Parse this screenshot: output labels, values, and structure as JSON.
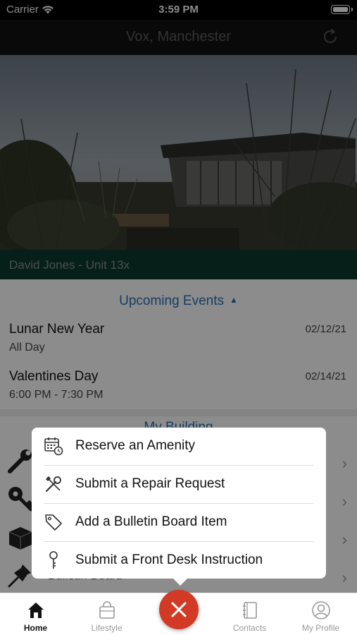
{
  "status_bar": {
    "carrier": "Carrier",
    "time": "3:59 PM"
  },
  "header": {
    "title": "Vox, Manchester"
  },
  "tenant": {
    "label": "David Jones - Unit 13x"
  },
  "events": {
    "heading": "Upcoming Events",
    "items": [
      {
        "name": "Lunar New Year",
        "when": "All Day",
        "date": "02/12/21"
      },
      {
        "name": "Valentines Day",
        "when": "6:00 PM - 7:30 PM",
        "date": "02/14/21"
      }
    ]
  },
  "building": {
    "heading": "My Building",
    "items": [
      {
        "label": "",
        "icon": "wrench-icon"
      },
      {
        "label": "",
        "icon": "key-icon"
      },
      {
        "label": "",
        "icon": "package-icon"
      },
      {
        "label": "Bulletin Board",
        "icon": "pushpin-icon"
      }
    ]
  },
  "action_menu": {
    "items": [
      {
        "label": "Reserve an Amenity",
        "icon": "calendar-clock-icon"
      },
      {
        "label": "Submit a Repair Request",
        "icon": "tools-icon"
      },
      {
        "label": "Add a Bulletin Board Item",
        "icon": "tag-icon"
      },
      {
        "label": "Submit a Front Desk Instruction",
        "icon": "key-icon"
      }
    ]
  },
  "tabs": [
    {
      "label": "Home",
      "icon": "home-icon",
      "active": true
    },
    {
      "label": "Lifestyle",
      "icon": "shopping-bag-icon",
      "active": false
    },
    {
      "label": "Contacts",
      "icon": "address-book-icon",
      "active": false
    },
    {
      "label": "My Profile",
      "icon": "profile-icon",
      "active": false
    }
  ],
  "colors": {
    "accent_blue": "#2a6fb5",
    "tenant_bar": "#0b3b2e",
    "fab_red": "#d23a26"
  }
}
